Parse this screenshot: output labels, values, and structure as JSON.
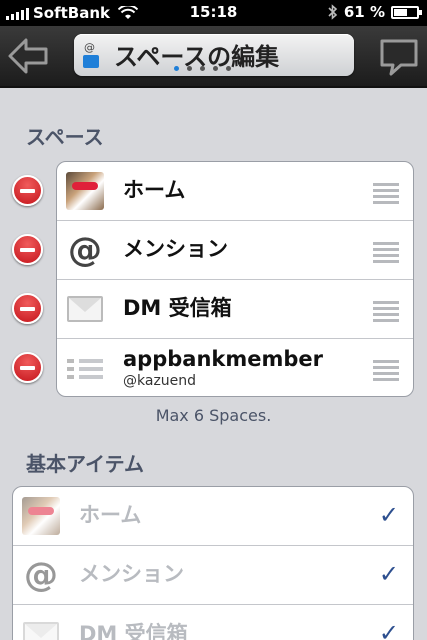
{
  "status_bar": {
    "carrier": "SoftBank",
    "time": "15:18",
    "battery": "61 %",
    "battery_level": 0.61
  },
  "nav": {
    "title": "スペースの編集",
    "page_count": 5,
    "active_page": 0
  },
  "sections": {
    "spaces_header": "スペース",
    "spaces_footer": "Max 6 Spaces.",
    "basic_header": "基本アイテム"
  },
  "spaces": [
    {
      "label": "ホーム",
      "icon": "dog-avatar-icon"
    },
    {
      "label": "メンション",
      "icon": "at-icon"
    },
    {
      "label": "DM 受信箱",
      "icon": "envelope-icon"
    },
    {
      "label": "appbankmember",
      "sub": "@kazuend",
      "icon": "list-icon"
    }
  ],
  "basic_items": [
    {
      "label": "ホーム",
      "icon": "dog-avatar-icon",
      "checked": true
    },
    {
      "label": "メンション",
      "icon": "at-icon",
      "checked": true
    },
    {
      "label": "DM 受信箱",
      "icon": "envelope-icon",
      "checked": true
    }
  ],
  "colors": {
    "accent": "#1f7fd8",
    "check": "#2d4f8f",
    "delete": "#c4141b",
    "header_text": "#4b5468"
  }
}
